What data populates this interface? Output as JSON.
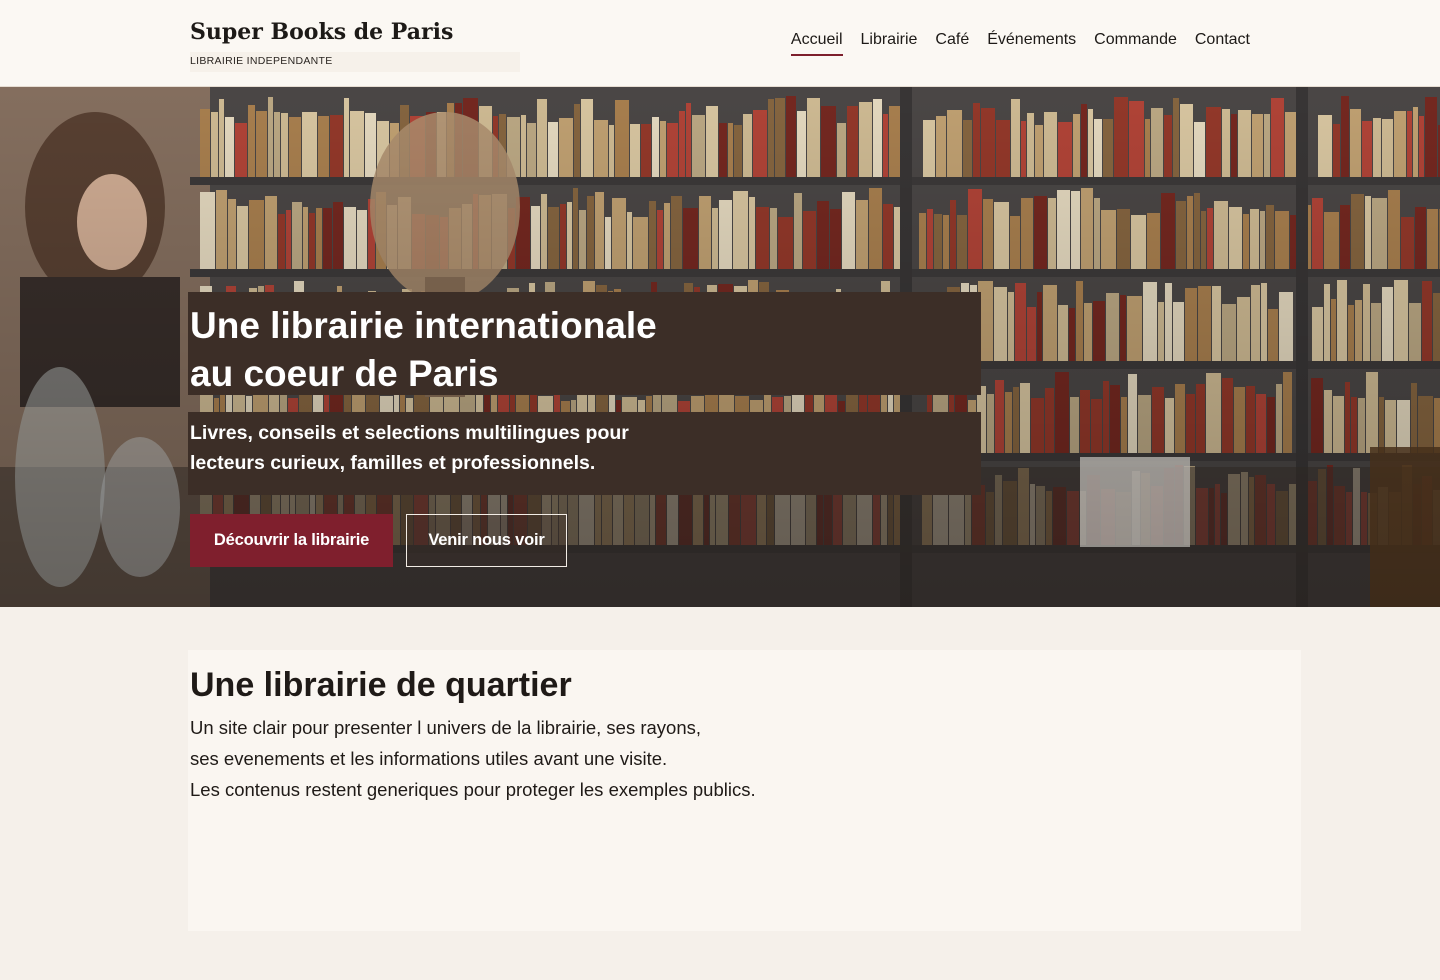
{
  "header": {
    "brand": "Super Books de Paris",
    "tagline": "LIBRAIRIE INDEPENDANTE",
    "nav": [
      {
        "label": "Accueil",
        "active": true
      },
      {
        "label": "Librairie",
        "active": false
      },
      {
        "label": "Café",
        "active": false
      },
      {
        "label": "Événements",
        "active": false
      },
      {
        "label": "Commande",
        "active": false
      },
      {
        "label": "Contact",
        "active": false
      }
    ]
  },
  "hero": {
    "title_lines": [
      "Une librairie internationale",
      "au coeur de Paris"
    ],
    "subtitle_lines": [
      "Livres, conseils et selections multilingues pour",
      "lecteurs curieux, familles et professionnels."
    ],
    "primary_button": "Découvrir la librairie",
    "secondary_button": "Venir nous voir"
  },
  "intro": {
    "title": "Une librairie de quartier",
    "lines": [
      "Un site clair pour presenter l univers de la librairie, ses rayons,",
      "ses evenements et les informations utiles avant une visite.",
      "Les contenus restent generiques pour proteger les exemples publics."
    ]
  },
  "colors": {
    "accent": "#7f1f2d",
    "header_bg": "#fbf8f3",
    "page_bg": "#f5f0ea",
    "hero_card": "#3c2e27"
  }
}
